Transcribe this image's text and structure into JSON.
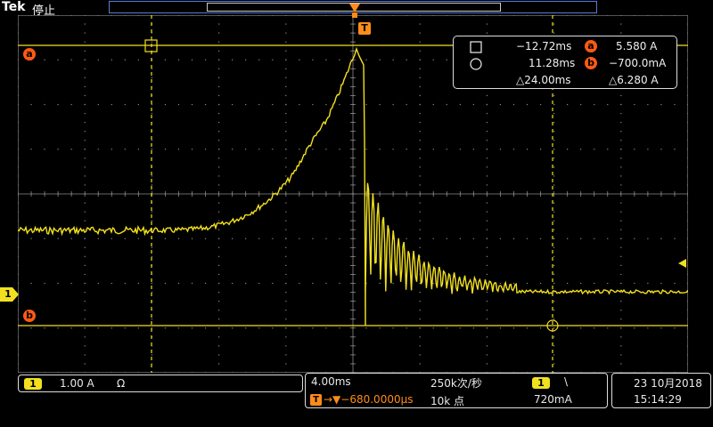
{
  "header": {
    "brand": "Tek",
    "run_state": "停止"
  },
  "markers": {
    "trigger": "T",
    "cursor_a": "a",
    "cursor_b": "b",
    "channel": "1"
  },
  "readout": {
    "row1_time": "−12.72ms",
    "row1_badge": "a",
    "row1_value": "5.580 A",
    "row2_time": "11.28ms",
    "row2_badge": "b",
    "row2_value": "−700.0mA",
    "delta_time": "△24.00ms",
    "delta_value": "△6.280 A"
  },
  "channel_panel": {
    "channel": "1",
    "scale": "1.00 A",
    "coupling": "Ω"
  },
  "timebase_panel": {
    "time_per_div": "4.00ms",
    "sample_rate": "250k次/秒",
    "trigger_icon": "T",
    "position": "→▼−680.0000µs",
    "record_length": "10k 点",
    "trigger_channel": "1",
    "trigger_slope": "\\",
    "trigger_level": "720mA"
  },
  "datetime": {
    "date": "23 10月2018",
    "time": "15:14:29"
  },
  "colors": {
    "trace": "#f2e020",
    "cursor": "#f2e020",
    "marker": "#ff5a14",
    "grid": "#8a8a8a",
    "record_bar": "#5b7bd5"
  }
}
